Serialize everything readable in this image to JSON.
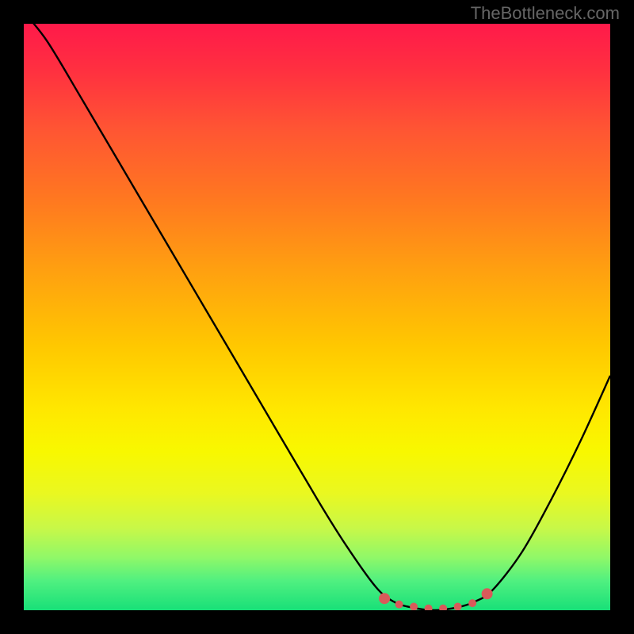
{
  "watermark": "TheBottleneck.com",
  "chart_data": {
    "type": "line",
    "title": "",
    "xlabel": "",
    "ylabel": "",
    "xlim": [
      0,
      1
    ],
    "ylim": [
      0,
      1
    ],
    "series": [
      {
        "name": "curve",
        "x": [
          0.0,
          0.04,
          0.1,
          0.2,
          0.3,
          0.4,
          0.5,
          0.55,
          0.6,
          0.63,
          0.66,
          0.7,
          0.74,
          0.77,
          0.8,
          0.85,
          0.9,
          0.95,
          1.0
        ],
        "y": [
          1.02,
          0.97,
          0.87,
          0.7,
          0.53,
          0.36,
          0.19,
          0.11,
          0.04,
          0.015,
          0.005,
          0.0,
          0.005,
          0.015,
          0.035,
          0.1,
          0.19,
          0.29,
          0.4
        ]
      }
    ],
    "markers": [
      {
        "x": 0.615,
        "y": 0.02,
        "r": 7
      },
      {
        "x": 0.64,
        "y": 0.01,
        "r": 5
      },
      {
        "x": 0.665,
        "y": 0.006,
        "r": 5
      },
      {
        "x": 0.69,
        "y": 0.003,
        "r": 5
      },
      {
        "x": 0.715,
        "y": 0.003,
        "r": 5
      },
      {
        "x": 0.74,
        "y": 0.006,
        "r": 5
      },
      {
        "x": 0.765,
        "y": 0.012,
        "r": 5
      },
      {
        "x": 0.79,
        "y": 0.028,
        "r": 7
      }
    ],
    "gradient_stops": [
      {
        "pos": 0.0,
        "color": "#ff1a4a"
      },
      {
        "pos": 0.55,
        "color": "#ffc800"
      },
      {
        "pos": 0.8,
        "color": "#eaf820"
      },
      {
        "pos": 1.0,
        "color": "#18e078"
      }
    ]
  }
}
